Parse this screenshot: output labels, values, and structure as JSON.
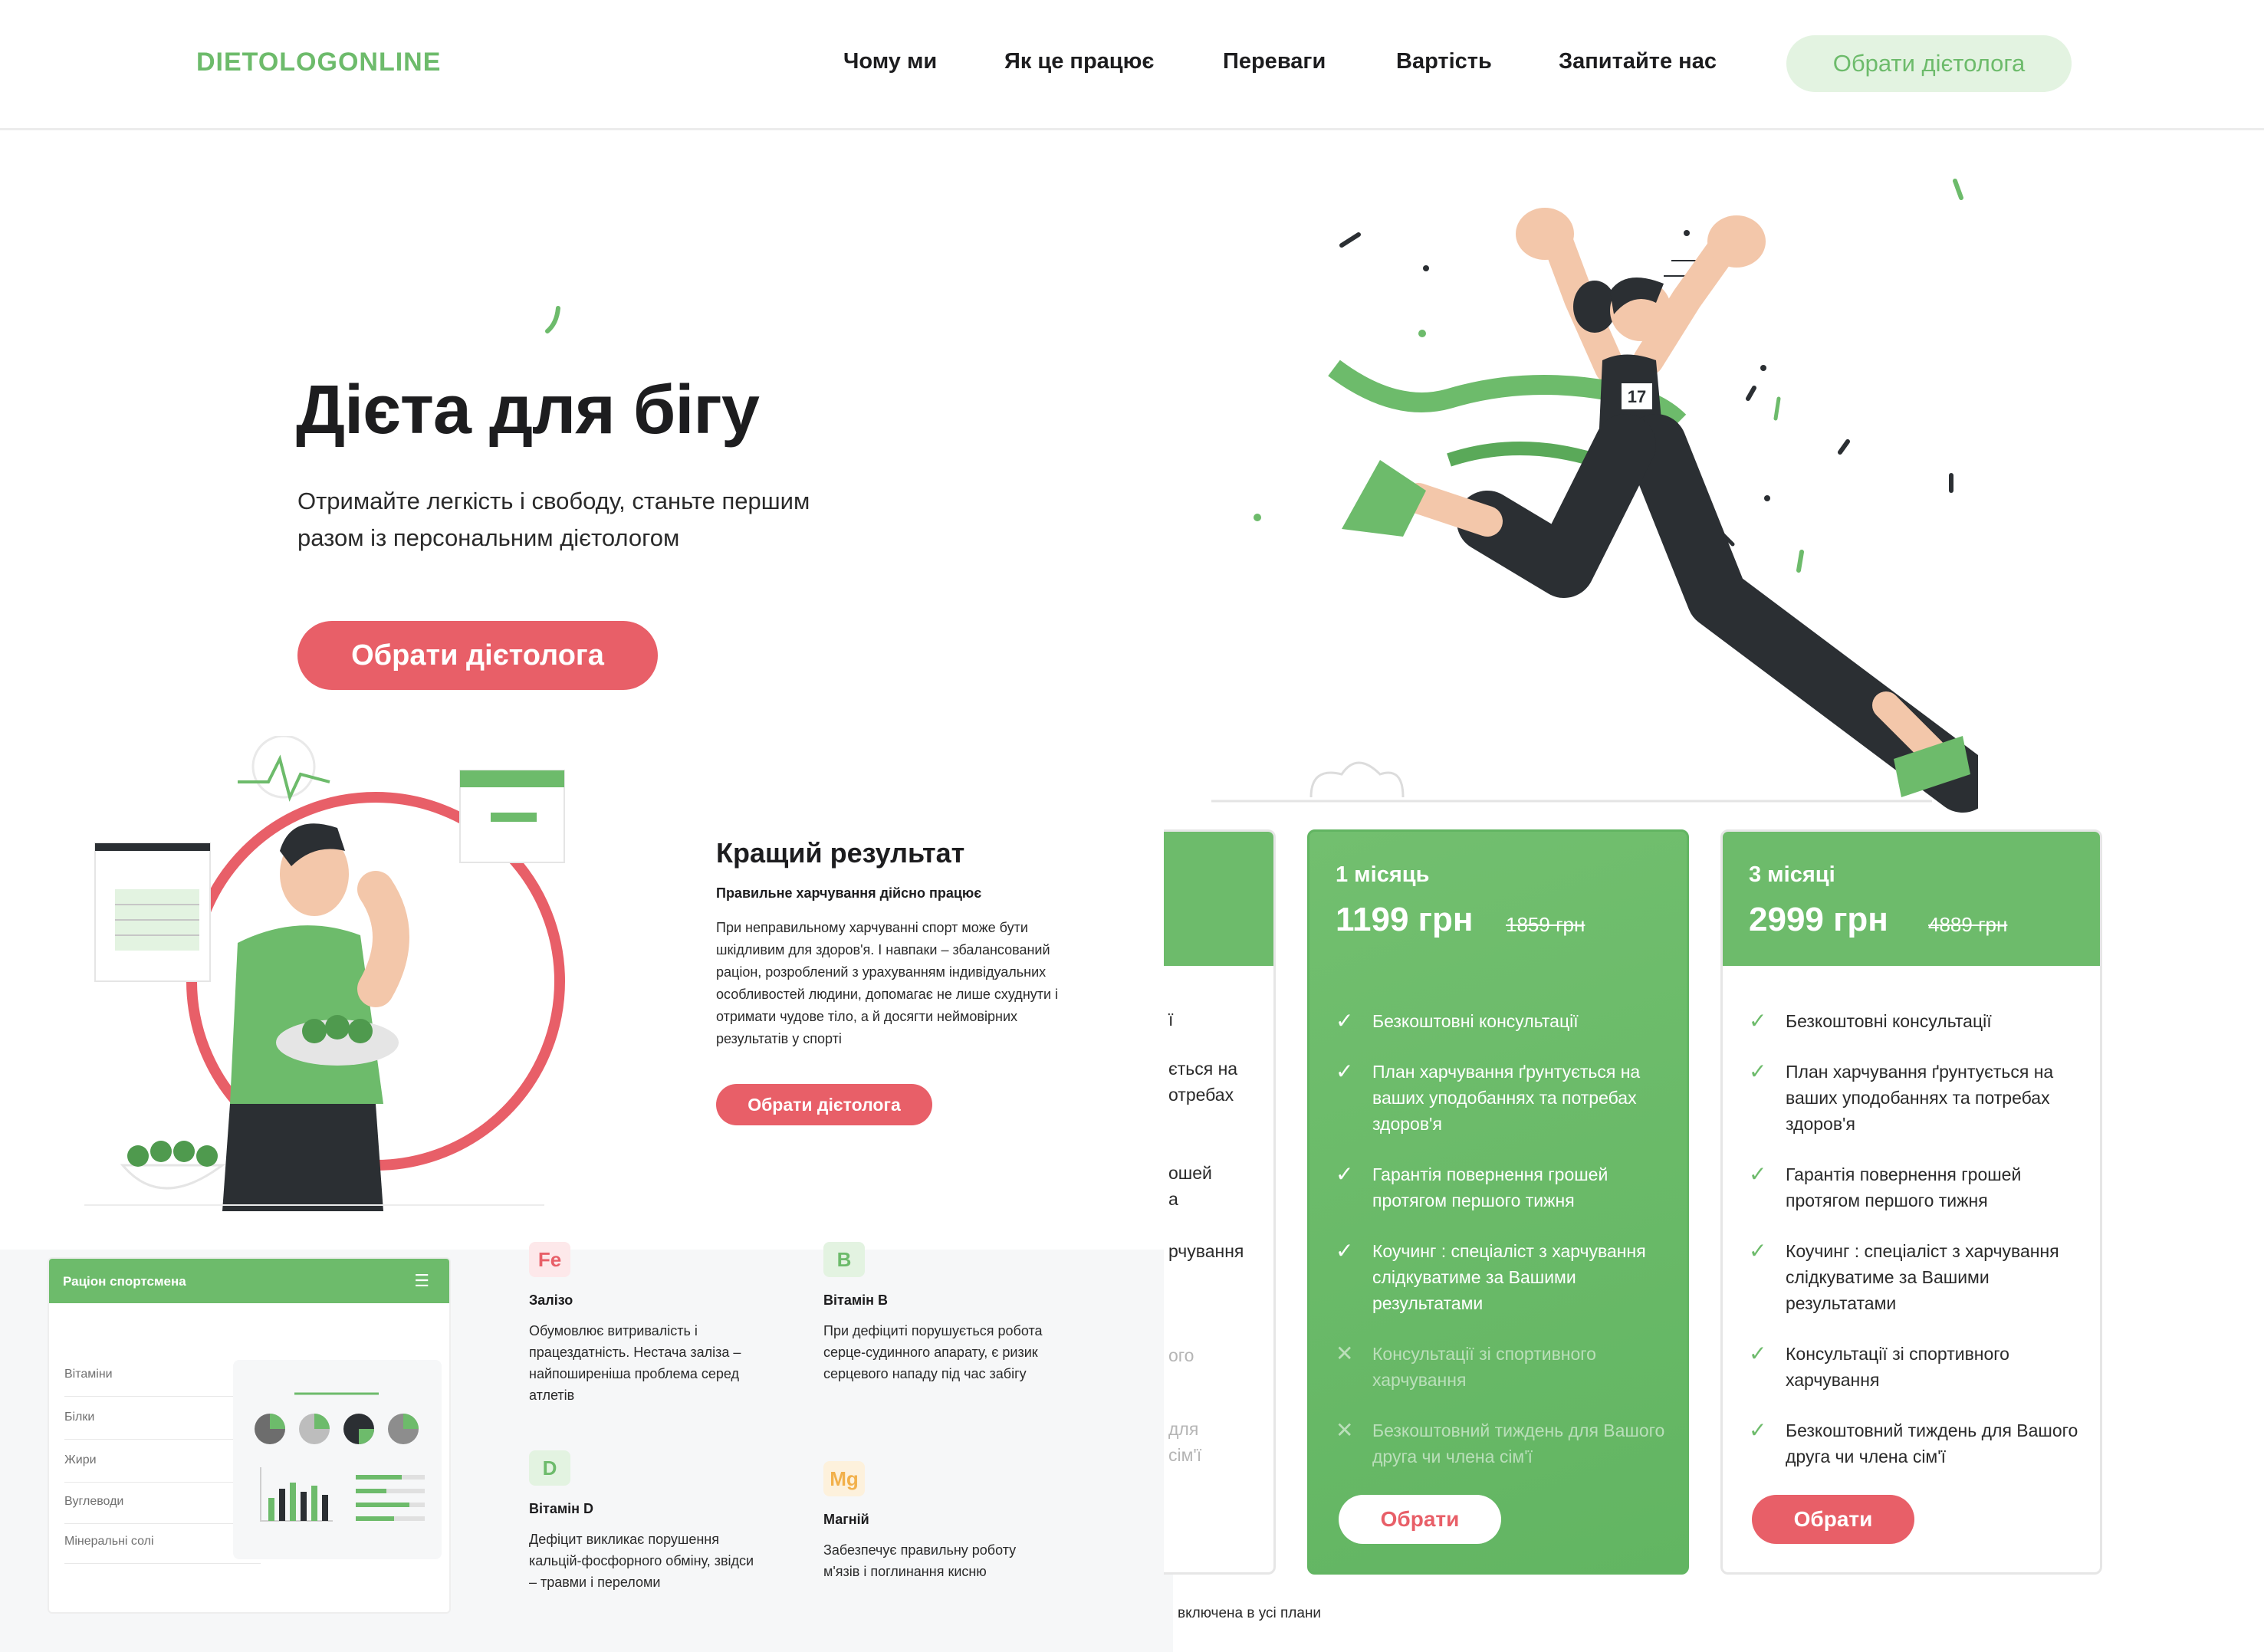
{
  "brand": "DIETOLOGONLINE",
  "nav": {
    "items": [
      "Чому ми",
      "Як це працює",
      "Переваги",
      "Вартість",
      "Запитайте нас"
    ],
    "cta": "Обрати дієтолога"
  },
  "hero": {
    "title": "Дієта для бігу",
    "subtitle": "Отримайте легкість і свободу, станьте першим разом із персональним дієтологом",
    "button": "Обрати дієтолога",
    "bib_number": "17"
  },
  "result": {
    "title": "Кращий результат",
    "subtitle": "Правильне харчування дійсно працює",
    "text": "При неправильному харчуванні спорт може бути шкідливим для здоров'я. І навпаки – збалансований раціон, розроблений з урахуванням індивідуальних особливостей людини, допомагає не лише схуднути і отримати чудове тіло, а й досягти неймовірних результатів у спорті",
    "button": "Обрати дієтолога"
  },
  "ration": {
    "title": "Раціон спортсмена",
    "rows": [
      "Вітаміни",
      "Білки",
      "Жири",
      "Вуглеводи",
      "Мінеральні солі"
    ]
  },
  "nutrients": [
    {
      "badge": "Fe",
      "title": "Залізо",
      "text": "Обумовлює витривалість і працездатність. Нестача заліза – найпоширеніша проблема серед атлетів",
      "color": "#e85f68",
      "bg": "#fde8ea"
    },
    {
      "badge": "B",
      "title": "Вітамін B",
      "text": "При дефіциті порушується робота серце-судинного апарату, є ризик серцевого нападу під час забігу",
      "color": "#6dbb6b",
      "bg": "#e3f3e1"
    },
    {
      "badge": "D",
      "title": "Вітамін D",
      "text": "Дефіцит викликає порушення кальцій-фосфорного обміну, звідси – травми і переломи",
      "color": "#6dbb6b",
      "bg": "#e3f3e1"
    },
    {
      "badge": "Mg",
      "title": "Магній",
      "text": "Забезпечує правильну роботу м'язів і поглинання кисню",
      "color": "#f2b04a",
      "bg": "#fdf1dc"
    }
  ],
  "pricing": {
    "partial_lines": [
      "ї",
      "ється на",
      "отребах",
      "ошей",
      "а",
      "рчування",
      "ого",
      "для",
      "сім'ї"
    ],
    "plans": [
      {
        "period": "1 місяць",
        "price": "1199 грн",
        "old_price": "1859 грн",
        "features": [
          {
            "text": "Безкоштовні консультації",
            "included": true
          },
          {
            "text": "План харчування ґрунтується на ваших уподобаннях та потребах здоров'я",
            "included": true
          },
          {
            "text": "Гарантія повернення грошей протягом першого тижня",
            "included": true
          },
          {
            "text": "Коучинг : спеціаліст з харчування слідкуватиме за Вашими результатами",
            "included": true
          },
          {
            "text": "Консультації зі спортивного харчування",
            "included": false
          },
          {
            "text": "Безкоштовний тиждень для Вашого друга чи члена сім'ї",
            "included": false
          }
        ],
        "button": "Обрати"
      },
      {
        "period": "3 місяці",
        "price": "2999 грн",
        "old_price": "4889 грн",
        "features": [
          {
            "text": "Безкоштовні консультації",
            "included": true
          },
          {
            "text": "План харчування ґрунтується на ваших уподобаннях та потребах здоров'я",
            "included": true
          },
          {
            "text": "Гарантія повернення грошей протягом першого тижня",
            "included": true
          },
          {
            "text": "Коучинг : спеціаліст з харчування слідкуватиме за Вашими результатами",
            "included": true
          },
          {
            "text": "Консультації зі спортивного харчування",
            "included": true
          },
          {
            "text": "Безкоштовний тиждень для Вашого друга чи члена сім'ї",
            "included": true
          }
        ],
        "button": "Обрати"
      }
    ],
    "footnote": "включена в усі плани"
  },
  "colors": {
    "green": "#6dbb6b",
    "red": "#e85f68",
    "dark": "#2b2f33",
    "skin": "#f3c7aa"
  }
}
